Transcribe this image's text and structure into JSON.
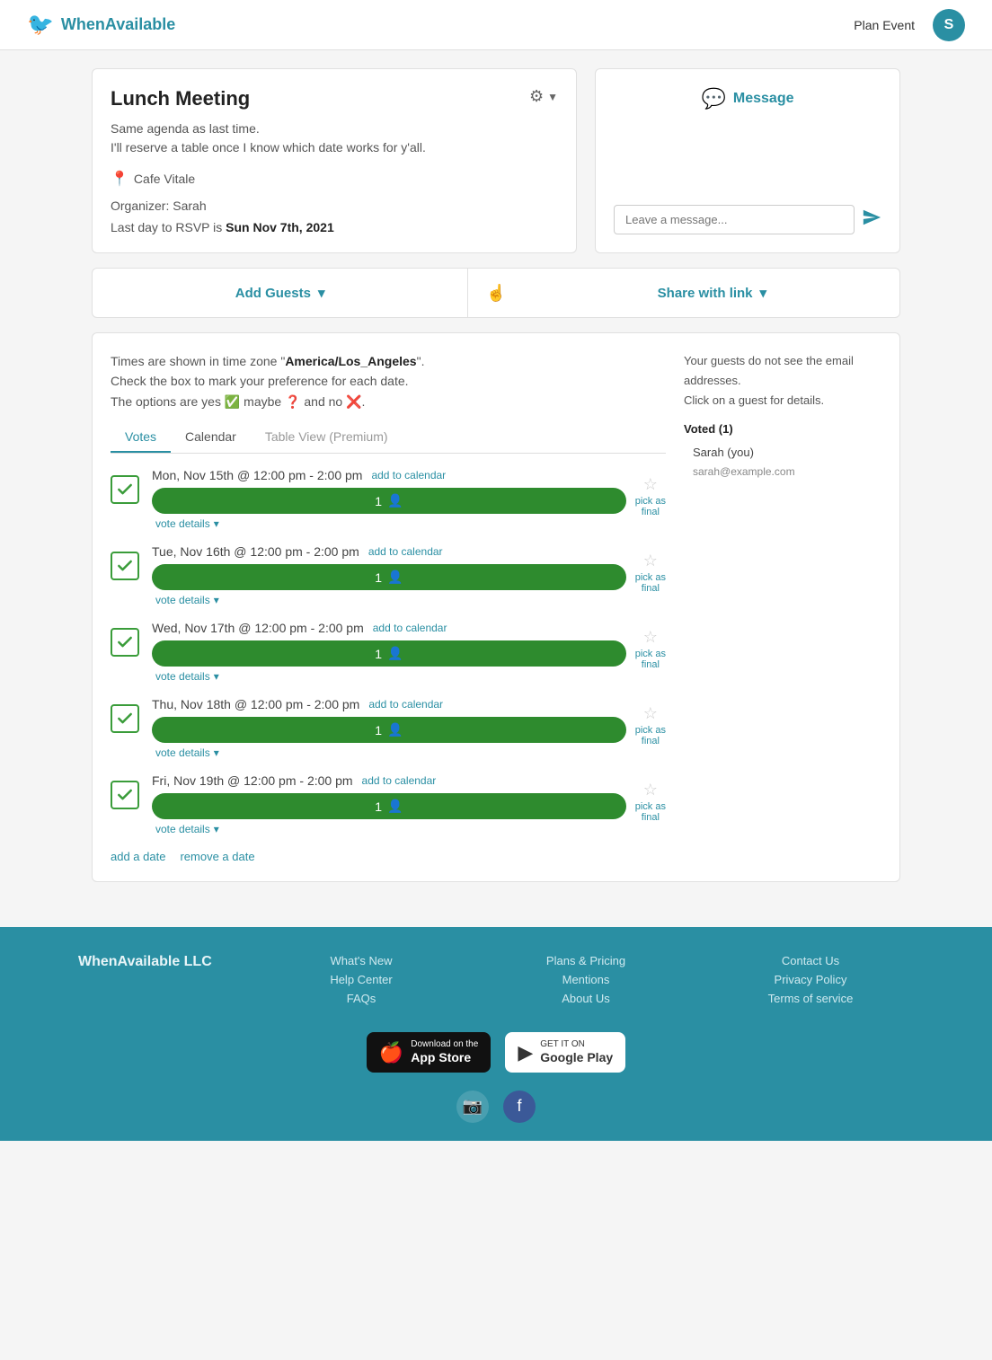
{
  "header": {
    "logo_text": "WhenAvailable",
    "plan_event_label": "Plan Event",
    "avatar_letter": "S"
  },
  "event": {
    "title": "Lunch Meeting",
    "description_line1": "Same agenda as last time.",
    "description_line2": "I'll reserve a table once I know which date works for y'all.",
    "location": "Cafe Vitale",
    "organizer_label": "Organizer:",
    "organizer_name": "Sarah",
    "rsvp_label": "Last day to RSVP is",
    "rsvp_date": "Sun Nov 7th, 2021"
  },
  "message": {
    "header": "Message",
    "placeholder": "Leave a message..."
  },
  "actions": {
    "add_guests_label": "Add Guests",
    "share_label": "Share with link"
  },
  "voting": {
    "timezone_prefix": "Times are shown in time zone \"",
    "timezone": "America/Los_Angeles",
    "timezone_suffix": "\".",
    "checkbox_line": "Check the box to mark your preference for each date.",
    "options_prefix": "The options are yes",
    "options_middle": "maybe",
    "options_suffix": "and no",
    "tabs": [
      "Votes",
      "Calendar",
      "Table View (Premium)"
    ],
    "active_tab": 0,
    "dates": [
      {
        "label": "Mon, Nov 15th @ 12:00 pm - 2:00 pm",
        "add_cal": "add to calendar",
        "votes": "1",
        "checked": true
      },
      {
        "label": "Tue, Nov 16th @ 12:00 pm - 2:00 pm",
        "add_cal": "add to calendar",
        "votes": "1",
        "checked": true
      },
      {
        "label": "Wed, Nov 17th @ 12:00 pm - 2:00 pm",
        "add_cal": "add to calendar",
        "votes": "1",
        "checked": true
      },
      {
        "label": "Thu, Nov 18th @ 12:00 pm - 2:00 pm",
        "add_cal": "add to calendar",
        "votes": "1",
        "checked": true
      },
      {
        "label": "Fri, Nov 19th @ 12:00 pm - 2:00 pm",
        "add_cal": "add to calendar",
        "votes": "1",
        "checked": true
      }
    ],
    "vote_details_label": "vote details",
    "pick_as_final": "pick as\nfinal",
    "add_date_label": "add a date",
    "remove_date_label": "remove a date",
    "guests_note": "Your guests do not see the email addresses.",
    "click_note": "Click on a guest for details.",
    "voted_label": "Voted (1)",
    "voted_user": "Sarah (you)",
    "voted_email": "sarah@example.com"
  },
  "footer": {
    "brand": "WhenAvailable LLC",
    "links_col1": [
      "What's New",
      "Help Center",
      "FAQs"
    ],
    "links_col2": [
      "Plans & Pricing",
      "Mentions",
      "About Us"
    ],
    "links_col3": [
      "Contact Us",
      "Privacy Policy",
      "Terms of service"
    ],
    "app_store_small": "Download on the",
    "app_store_big": "App Store",
    "google_play_small": "GET IT ON",
    "google_play_big": "Google Play"
  }
}
